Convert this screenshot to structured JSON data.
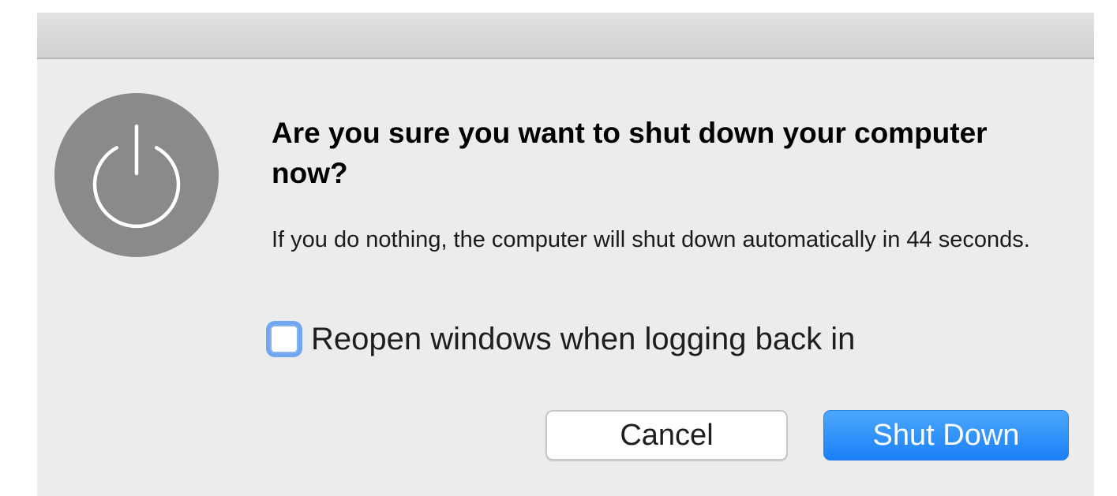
{
  "dialog": {
    "icon": "power-icon",
    "title": "Are you sure you want to shut down your computer now?",
    "message": "If you do nothing, the computer will shut down automatically in 44 seconds.",
    "countdown_seconds": 44,
    "checkbox": {
      "label": "Reopen windows when logging back in",
      "checked": false
    },
    "buttons": {
      "cancel_label": "Cancel",
      "shutdown_label": "Shut Down"
    }
  },
  "colors": {
    "accent": "#1b80f8",
    "icon_background": "#8a8a8a",
    "dialog_background": "#ececec"
  }
}
